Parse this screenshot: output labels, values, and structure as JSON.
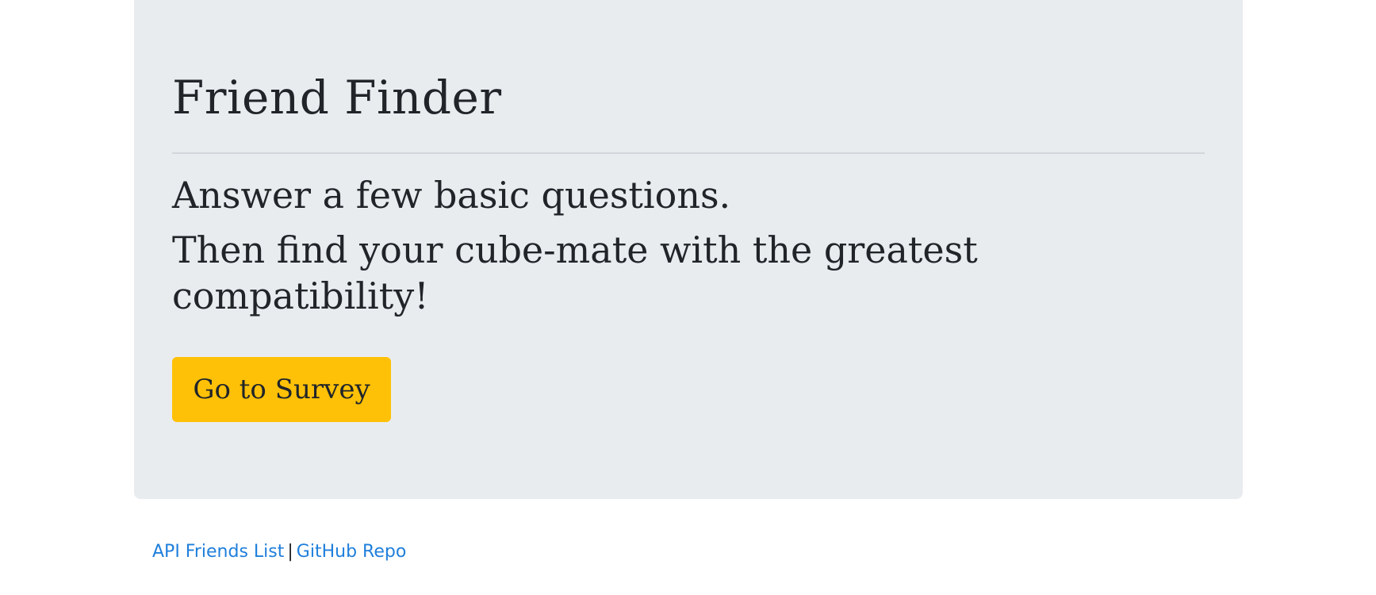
{
  "jumbotron": {
    "title": "Friend Finder",
    "lead_line_1": "Answer a few basic questions.",
    "lead_line_2": "Then find your cube-mate with the greatest compatibility!",
    "button_label": "Go to Survey"
  },
  "footer": {
    "api_link_label": "API Friends List",
    "separator": "|",
    "github_link_label": "GitHub Repo"
  },
  "colors": {
    "jumbotron_bg": "#e9ecef",
    "button_bg": "#ffc107",
    "link": "#1f7fdb",
    "text": "#212529"
  }
}
